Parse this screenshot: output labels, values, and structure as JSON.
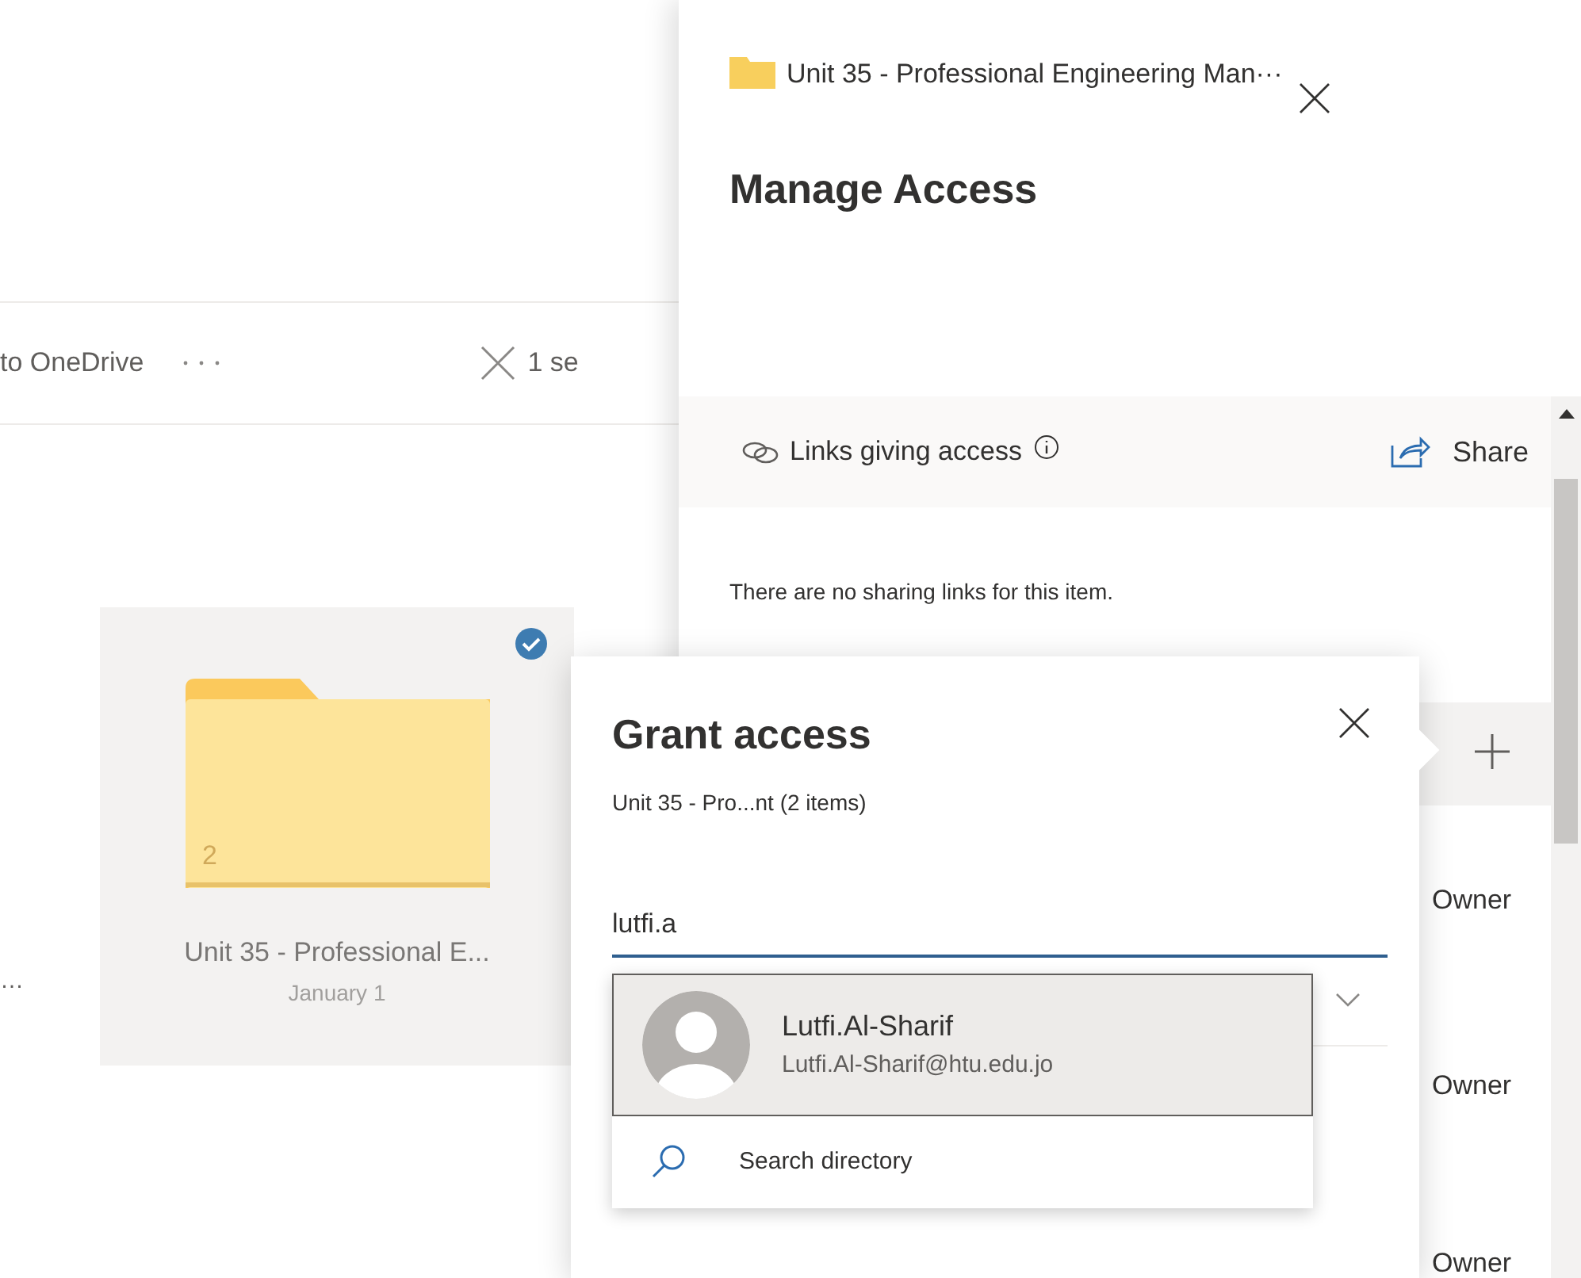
{
  "command_bar": {
    "action": "to OneDrive",
    "selection_text": "1 se"
  },
  "files": [
    {
      "name": "…",
      "selected": false
    },
    {
      "name": "Unit 35 - Professional E...",
      "date": "January 1",
      "count": "2",
      "selected": true
    }
  ],
  "manage_access": {
    "item_title": "Unit 35 - Professional Engineering Man···",
    "title": "Manage Access",
    "links_heading": "Links giving access",
    "share": "Share",
    "no_links": "There are no sharing links for this item.",
    "permissions": [
      "Owner",
      "Owner",
      "Owner"
    ]
  },
  "grant_access": {
    "title": "Grant access",
    "subtitle": "Unit 35 - Pro...nt (2 items)",
    "input_value": "lutfi.a",
    "suggestions": [
      {
        "name": "Lutfi.Al-Sharif",
        "email": "Lutfi.Al-Sharif@htu.edu.jo",
        "selected": true
      }
    ],
    "search_directory": "Search directory"
  }
}
